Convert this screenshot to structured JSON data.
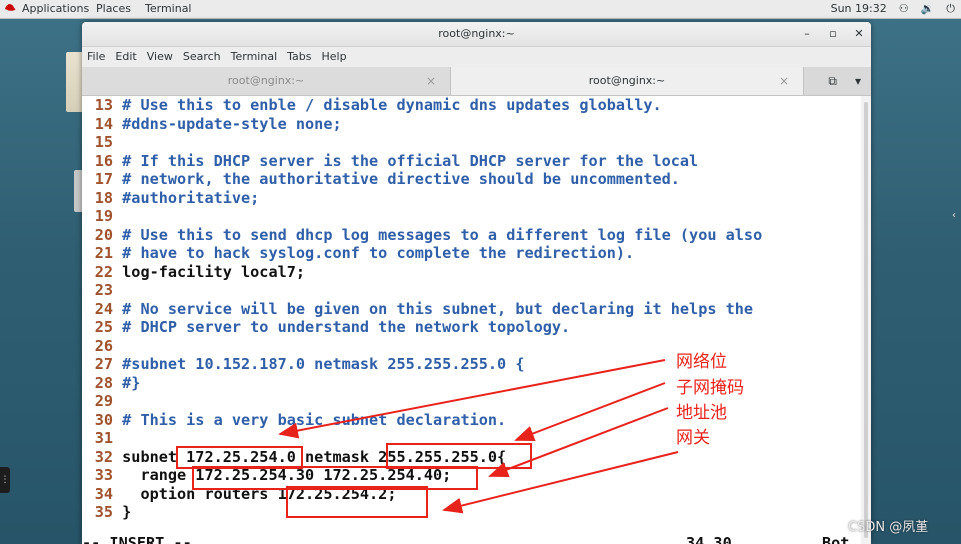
{
  "top_panel": {
    "applications": "Applications",
    "places": "Places",
    "terminal": "Terminal",
    "clock": "Sun 19:32",
    "icons": [
      "network-icon",
      "volume-icon",
      "power-icon"
    ]
  },
  "window": {
    "title": "root@nginx:~",
    "menu": [
      "File",
      "Edit",
      "View",
      "Search",
      "Terminal",
      "Tabs",
      "Help"
    ],
    "tabs": [
      {
        "label": "root@nginx:~",
        "active": false
      },
      {
        "label": "root@nginx:~",
        "active": true
      }
    ]
  },
  "editor": {
    "lines": [
      {
        "n": "13",
        "text": "# Use this to enble / disable dynamic dns updates globally.",
        "comment": true
      },
      {
        "n": "14",
        "text": "#ddns-update-style none;",
        "comment": true
      },
      {
        "n": "15",
        "text": "",
        "comment": false
      },
      {
        "n": "16",
        "text": "# If this DHCP server is the official DHCP server for the local",
        "comment": true
      },
      {
        "n": "17",
        "text": "# network, the authoritative directive should be uncommented.",
        "comment": true
      },
      {
        "n": "18",
        "text": "#authoritative;",
        "comment": true
      },
      {
        "n": "19",
        "text": "",
        "comment": false
      },
      {
        "n": "20",
        "text": "# Use this to send dhcp log messages to a different log file (you also",
        "comment": true
      },
      {
        "n": "21",
        "text": "# have to hack syslog.conf to complete the redirection).",
        "comment": true
      },
      {
        "n": "22",
        "text": "log-facility local7;",
        "comment": false
      },
      {
        "n": "23",
        "text": "",
        "comment": false
      },
      {
        "n": "24",
        "text": "# No service will be given on this subnet, but declaring it helps the",
        "comment": true
      },
      {
        "n": "25",
        "text": "# DHCP server to understand the network topology.",
        "comment": true
      },
      {
        "n": "26",
        "text": "",
        "comment": false
      },
      {
        "n": "27",
        "text": "#subnet 10.152.187.0 netmask 255.255.255.0 {",
        "comment": true
      },
      {
        "n": "28",
        "text": "#}",
        "comment": true
      },
      {
        "n": "29",
        "text": "",
        "comment": false
      },
      {
        "n": "30",
        "text": "# This is a very basic subnet declaration.",
        "comment": true
      },
      {
        "n": "31",
        "text": "",
        "comment": false
      },
      {
        "n": "32",
        "text": "subnet 172.25.254.0 netmask 255.255.255.0{",
        "comment": false
      },
      {
        "n": "33",
        "text": "  range 172.25.254.30 172.25.254.40;",
        "comment": false
      },
      {
        "n": "34",
        "text": "  option routers 172.25.254.2;",
        "comment": false
      },
      {
        "n": "35",
        "text": "}",
        "comment": false
      }
    ],
    "mode": "-- INSERT --",
    "cursor_pos": "34,30",
    "scroll_pos": "Bot"
  },
  "annotations": {
    "labels": [
      "网络位",
      "子网掩码",
      "地址池",
      "网关"
    ],
    "color": "#e8231b"
  },
  "watermark": "CSDN @夙堇"
}
